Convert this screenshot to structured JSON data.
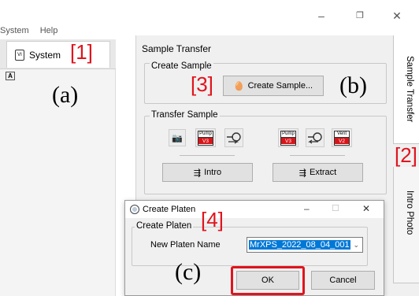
{
  "window": {
    "minimize": "–",
    "restore": "❐",
    "close": "✕"
  },
  "menu": {
    "items": [
      "System",
      "Help"
    ]
  },
  "left_panel": {
    "tab_label": "System",
    "small_button": "A"
  },
  "annotations": {
    "a": "(a)",
    "b": "(b)",
    "c": "(c)",
    "n1": "[1]",
    "n2": "[2]",
    "n3": "[3]",
    "n4": "[4]"
  },
  "sample_transfer": {
    "title": "Sample Transfer",
    "create_sample": {
      "group": "Create Sample",
      "button": "Create Sample..."
    },
    "transfer_sample": {
      "group": "Transfer Sample",
      "pump_left": {
        "top": "Pump",
        "bottom": "V3"
      },
      "pump_right": {
        "top": "Pump",
        "bottom": "V3"
      },
      "vent": {
        "top": "Vent",
        "bottom": "V2"
      },
      "intro_button": "Intro",
      "extract_button": "Extract"
    }
  },
  "vertical_tabs": [
    "Sample Transfer",
    "Intro Photo"
  ],
  "dialog": {
    "title": "Create Platen",
    "group": "Create Platen",
    "field_label": "New Platen Name",
    "field_value": "MrXPS_2022_08_04_001",
    "ok": "OK",
    "cancel": "Cancel",
    "minimize": "–",
    "maximize": "☐",
    "close": "✕"
  },
  "colors": {
    "annotation_red": "#e0141e",
    "selection_blue": "#0078d7"
  }
}
